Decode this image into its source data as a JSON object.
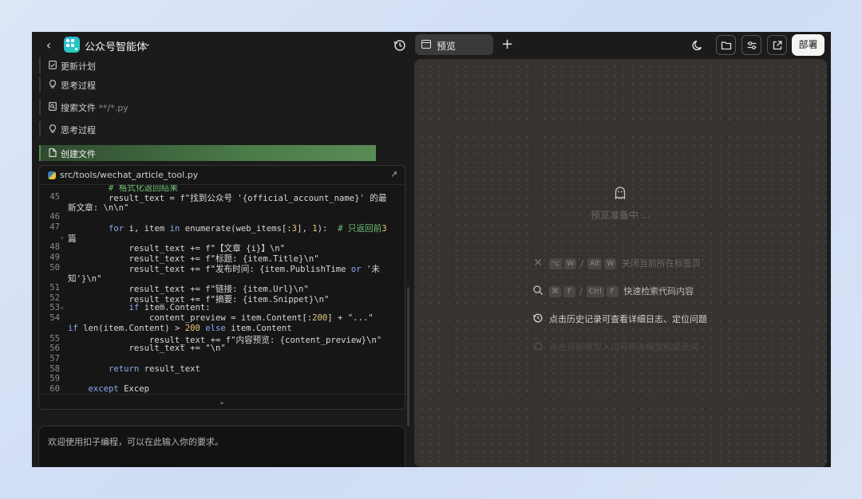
{
  "header": {
    "app_title": "公众号智能体",
    "preview_tab": "预览",
    "deploy_label": "部署"
  },
  "steps": [
    {
      "label": "更新计划",
      "icon": "plan-icon"
    },
    {
      "label": "思考过程",
      "icon": "lightbulb-icon"
    },
    {
      "label": "搜索文件",
      "extra": "**/*.py",
      "icon": "search-file-icon"
    },
    {
      "label": "思考过程",
      "icon": "lightbulb-icon"
    },
    {
      "label": "创建文件",
      "icon": "file-icon",
      "active": true
    }
  ],
  "code": {
    "file_path": "src/tools/wechat_article_tool.py",
    "lines": [
      {
        "n": "",
        "t": "        # 格式化返回结果"
      },
      {
        "n": "45",
        "t": "        result_text = f\"找到公众号 '{official_account_name}' 的最"
      },
      {
        "n": "",
        "t": "新文章: \\n\\n\""
      },
      {
        "n": "46",
        "t": ""
      },
      {
        "n": "47",
        "t": "        for i, item in enumerate(web_items[:3], 1):  # 只返回前3",
        "fold": true
      },
      {
        "n": "",
        "t": "篇"
      },
      {
        "n": "48",
        "t": "            result_text += f\"【文章 {i}】\\n\""
      },
      {
        "n": "49",
        "t": "            result_text += f\"标题: {item.Title}\\n\""
      },
      {
        "n": "50",
        "t": "            result_text += f\"发布时间: {item.PublishTime or '未"
      },
      {
        "n": "",
        "t": "知'}\\n\""
      },
      {
        "n": "51",
        "t": "            result_text += f\"链接: {item.Url}\\n\""
      },
      {
        "n": "52",
        "t": "            result_text += f\"摘要: {item.Snippet}\\n\""
      },
      {
        "n": "53",
        "t": "            if item.Content:",
        "fold": true
      },
      {
        "n": "54",
        "t": "                content_preview = item.Content[:200] + \"...\""
      },
      {
        "n": "",
        "t": "if len(item.Content) > 200 else item.Content"
      },
      {
        "n": "55",
        "t": "                result_text += f\"内容预览: {content_preview}\\n\""
      },
      {
        "n": "56",
        "t": "            result_text += \"\\n\""
      },
      {
        "n": "57",
        "t": ""
      },
      {
        "n": "58",
        "t": "        return result_text"
      },
      {
        "n": "59",
        "t": ""
      },
      {
        "n": "60",
        "t": "    except Excep"
      }
    ]
  },
  "input": {
    "placeholder": "欢迎使用扣子编程，可以在此输入你的要求。"
  },
  "preview": {
    "status": "预览准备中 ...",
    "hints": [
      {
        "keys_a": [
          "⌥",
          "W"
        ],
        "keys_b": [
          "Alt",
          "W"
        ],
        "text": "关闭当前所在标签页",
        "icon": "close-icon"
      },
      {
        "keys_a": [
          "⌘",
          "F"
        ],
        "keys_b": [
          "Ctrl",
          "F"
        ],
        "text": "快速检索代码内容",
        "icon": "search-icon"
      },
      {
        "text": "点击历史记录可查看详细日志、定位问题",
        "icon": "history-icon"
      },
      {
        "text": "点击顶部模型入口可修改模型和提示词",
        "icon": "model-icon"
      }
    ]
  },
  "colors": {
    "accent_green": "#5a8c55",
    "preview_bg": "#363331",
    "app_bg": "#1b1b1b"
  }
}
